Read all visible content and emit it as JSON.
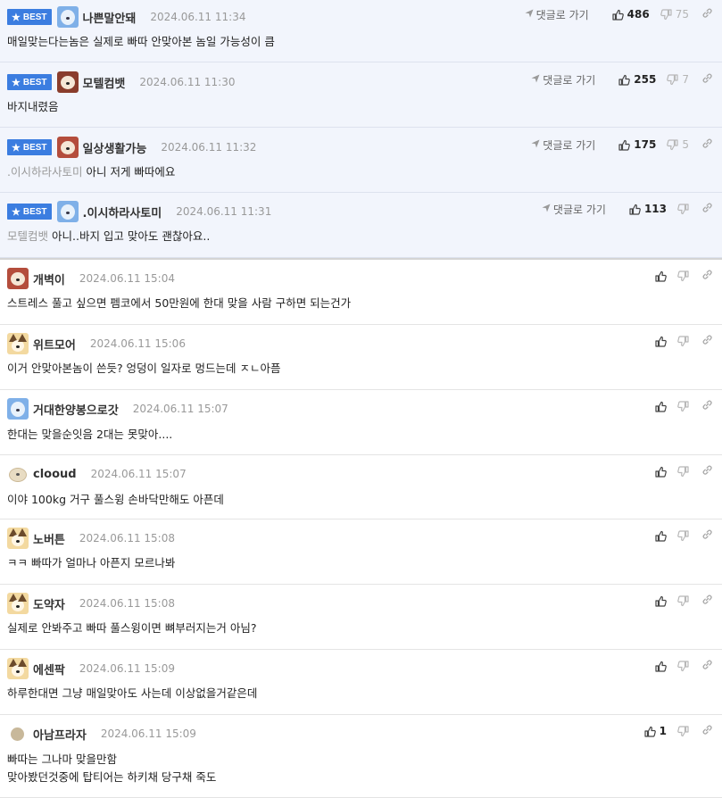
{
  "labels": {
    "best": "BEST",
    "reply": "댓글로 가기"
  },
  "colors": {
    "best_badge": "#3b7de0",
    "best_bg": "#f2f5fc",
    "date": "#999999"
  },
  "icons": {
    "best": "star-icon",
    "reply": "send-arrow-icon",
    "up": "thumbs-up-icon",
    "down": "thumbs-down-icon",
    "link": "link-icon"
  },
  "best_comments": [
    {
      "avatar": "blue-dog-icon",
      "nick": "나쁜말안돼",
      "date": "2024.06.11 11:34",
      "mention": "",
      "text": "매일맞는다는놈은 실제로 빠따 안맞아본 놈일 가능성이 큼",
      "up": "486",
      "down": "75"
    },
    {
      "avatar": "white-dog-icon",
      "nick": "모텔컴뱃",
      "date": "2024.06.11 11:30",
      "mention": "",
      "text": "바지내렸음",
      "up": "255",
      "down": "7"
    },
    {
      "avatar": "bear-icon",
      "nick": "일상생활가능",
      "date": "2024.06.11 11:32",
      "mention": ".이시하라사토미",
      "text": "아니 저게 빠따에요",
      "up": "175",
      "down": "5"
    },
    {
      "avatar": "blue-dog-icon",
      "nick": ".이시하라사토미",
      "date": "2024.06.11 11:31",
      "mention": "모텔컴뱃",
      "text": "아니..바지 입고 맞아도 괜찮아요..",
      "up": "113",
      "down": ""
    }
  ],
  "comments": [
    {
      "avatar": "bear-icon",
      "nick": "개벽이",
      "date": "2024.06.11 15:04",
      "lines": [
        "스트레스 풀고 싶으면 펨코에서 50만원에 한대 맞을 사람 구하면 되는건가"
      ],
      "up": "",
      "down": ""
    },
    {
      "avatar": "chihuahua-icon",
      "nick": "위트모어",
      "date": "2024.06.11 15:06",
      "lines": [
        "이거 안맞아본놈이 쓴듯? 엉덩이 일자로 멍드는데 ㅈㄴ아픔"
      ],
      "up": "",
      "down": ""
    },
    {
      "avatar": "blue-dog-icon",
      "nick": "거대한양봉으로갓",
      "date": "2024.06.11 15:07",
      "lines": [
        "한대는 맞을순잇음 2대는 못맞아...."
      ],
      "up": "",
      "down": ""
    },
    {
      "avatar": "fluffy-dog-icon",
      "nick": "clooud",
      "date": "2024.06.11 15:07",
      "lines": [
        "이야 100kg 거구 풀스윙 손바닥만해도 아픈데"
      ],
      "up": "",
      "down": ""
    },
    {
      "avatar": "chihuahua-icon",
      "nick": "노버튼",
      "date": "2024.06.11 15:08",
      "lines": [
        "ㅋㅋ 빠따가 얼마나 아픈지 모르나봐"
      ],
      "up": "",
      "down": ""
    },
    {
      "avatar": "chihuahua-icon",
      "nick": "도약자",
      "date": "2024.06.11 15:08",
      "lines": [
        "실제로 안봐주고 빠따 풀스윙이면 뼈부러지는거 아님?"
      ],
      "up": "",
      "down": ""
    },
    {
      "avatar": "chihuahua-icon",
      "nick": "에센팍",
      "date": "2024.06.11 15:09",
      "lines": [
        "하루한대면 그냥 매일맞아도 사는데 이상없을거같은데"
      ],
      "up": "",
      "down": ""
    },
    {
      "avatar": "default-dot-icon",
      "nick": "아남프라자",
      "date": "2024.06.11 15:09",
      "lines": [
        "빠따는 그나마 맞을만함",
        "맞아봤던것중에 탑티어는 하키채 당구채 죽도"
      ],
      "up": "1",
      "down": ""
    }
  ]
}
